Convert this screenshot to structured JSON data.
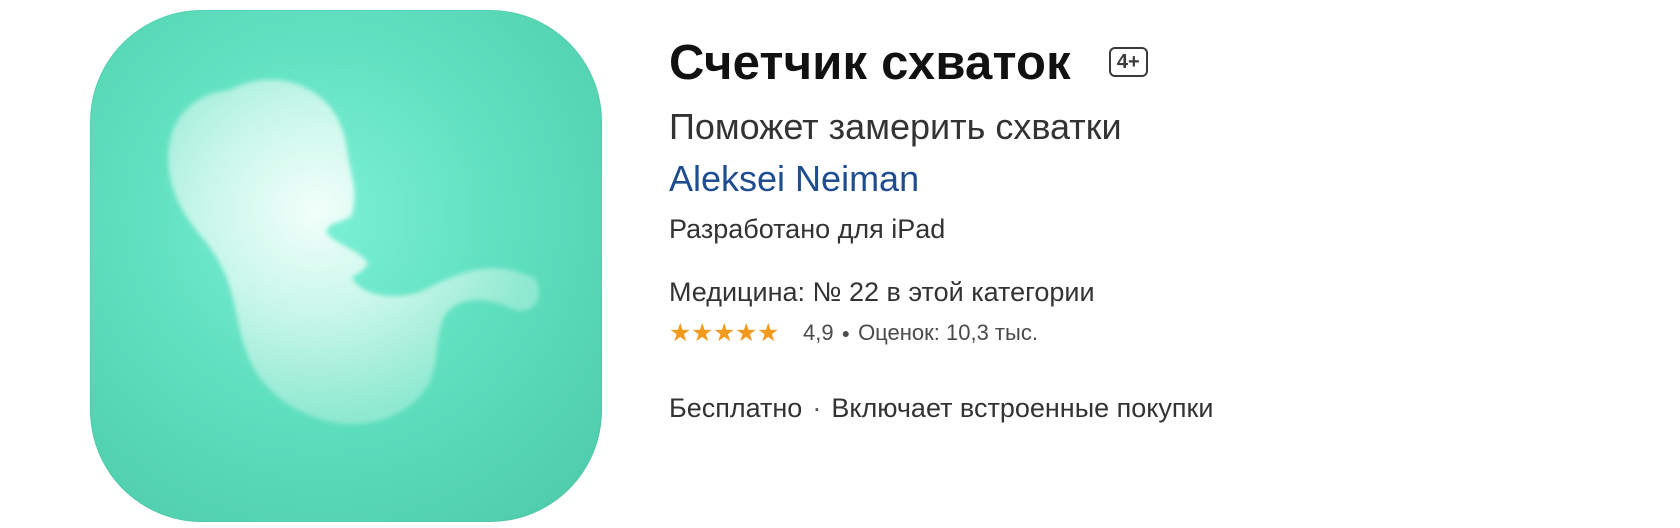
{
  "app": {
    "icon_name": "embryo-icon",
    "title": "Счетчик схваток",
    "age_rating": "4+",
    "subtitle": "Поможет замерить схватки",
    "developer": "Aleksei Neiman",
    "designed_for": "Разработано для iPad",
    "category_rank": "Медицина: № 22 в этой категории",
    "rating": {
      "stars": 4.9,
      "value_text": "4,9",
      "count_text": "Оценок: 10,3 тыс."
    },
    "price": "Бесплатно",
    "in_app_purchases": "Включает встроенные покупки"
  },
  "colors": {
    "icon_bg": "#5fe0bf",
    "developer_link": "#1f4d8f",
    "stars": "#f29a1d"
  }
}
